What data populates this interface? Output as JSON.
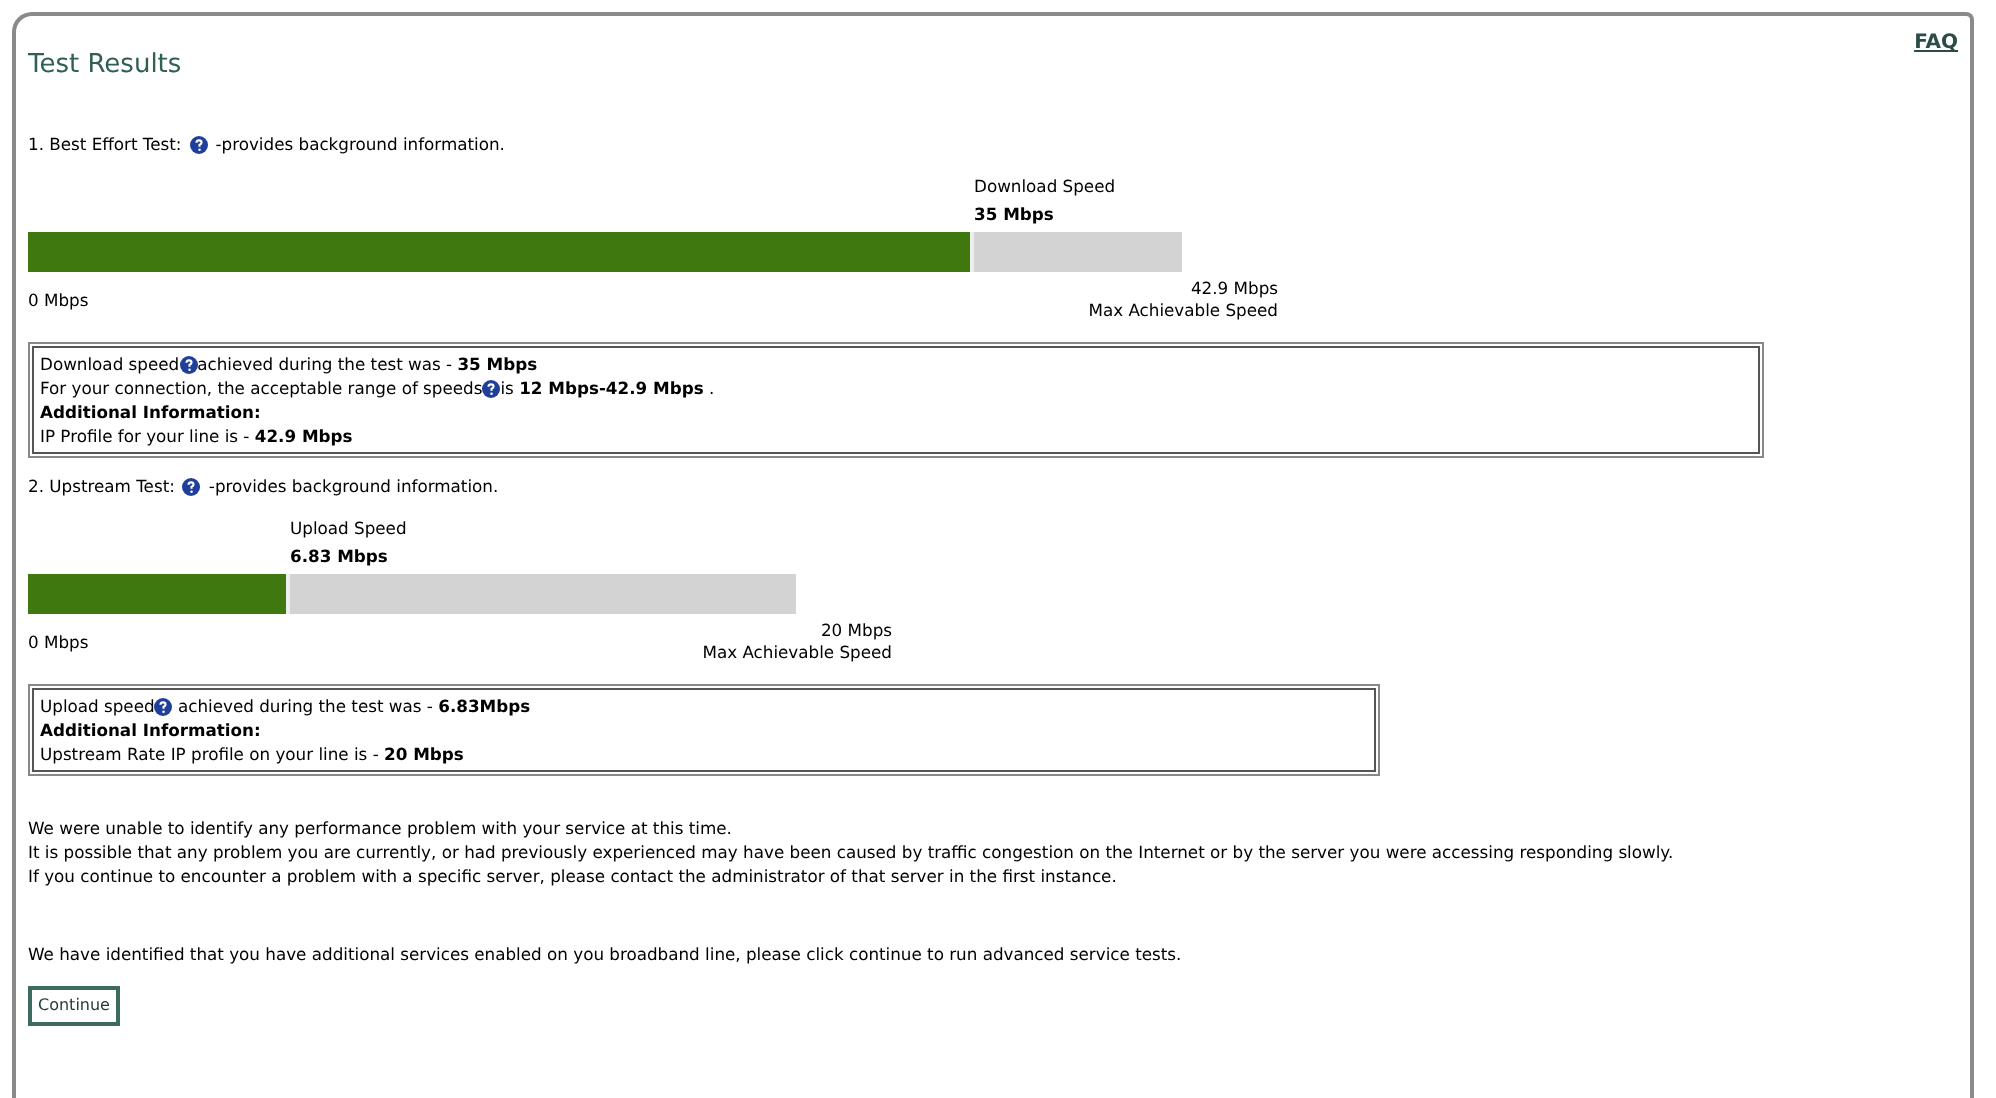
{
  "faq_link": "FAQ",
  "title": "Test Results",
  "tests": [
    {
      "heading": "1. Best Effort Test:",
      "help_text": "-provides background information.",
      "speed_label": "Download Speed",
      "speed_value": "35 Mbps",
      "level": 0.82,
      "min_label": "0 Mbps",
      "max_value": "42.9 Mbps",
      "max_caption": "Max Achievable Speed",
      "info": [
        {
          "text": "Download speed",
          "help": true,
          "rest": "achieved during the test was - **35 Mbps**"
        },
        {
          "text": "For your connection, the acceptable range of speeds",
          "help": true,
          "rest": "is **12 Mbps-42.9 Mbps** ."
        },
        {
          "text": "**Additional Information:**",
          "help": false
        },
        {
          "text": "IP Profile for your line is - **42.9 Mbps**",
          "help": false
        }
      ]
    },
    {
      "heading": "2. Upstream Test:",
      "help_text": "-provides background information.",
      "speed_label": "Upload Speed",
      "speed_value": "6.83 Mbps",
      "level": 0.34,
      "min_label": "0 Mbps",
      "max_value": "20 Mbps",
      "max_caption": "Max Achievable Speed",
      "info": [
        {
          "text": "Upload speed",
          "help": true,
          "rest": " achieved during the test was - **6.83Mbps**"
        },
        {
          "text": "**Additional Information:**",
          "help": false
        },
        {
          "text": "Upstream Rate IP profile on your line is - **20 Mbps**",
          "help": false
        }
      ]
    }
  ],
  "messages": [
    "We were unable to identify any performance problem with your service at this time.",
    "It is possible that any problem you are currently, or had previously experienced may have been caused by traffic congestion on the Internet or by the server you were accessing responding slowly.",
    "If you continue to encounter a problem with a specific server, please contact the administrator of that server in the first instance."
  ],
  "notice": "We have identified that you have additional services enabled on you broadband line, please click continue to run advanced service tests.",
  "continue_button": "Continue"
}
